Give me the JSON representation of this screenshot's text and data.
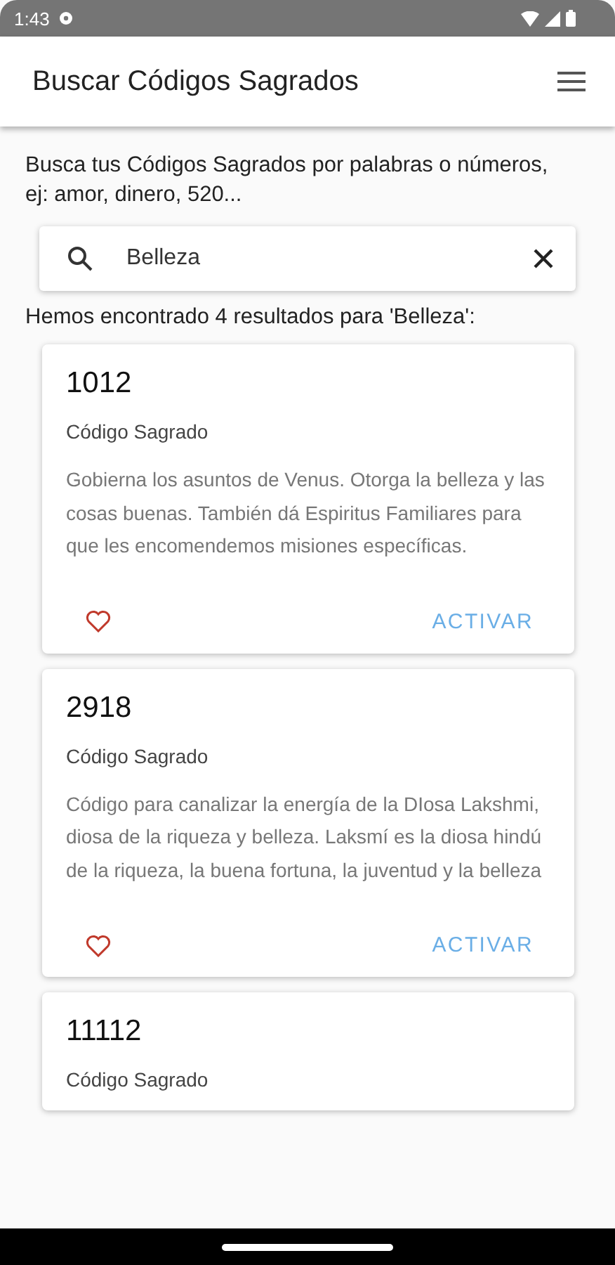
{
  "status_bar": {
    "time": "1:43"
  },
  "app_bar": {
    "title": "Buscar Códigos Sagrados"
  },
  "intro": "Busca tus Códigos Sagrados por palabras o números, ej: amor, dinero, 520...",
  "search": {
    "value": "Belleza"
  },
  "results_label": "Hemos encontrado 4 resultados para 'Belleza':",
  "results": [
    {
      "code": "1012",
      "subtitle": "Código Sagrado",
      "description": "Gobierna los asuntos de Venus. Otorga la belleza y las cosas buenas. También dá Espiritus Familiares para que les encomendemos misiones específicas.",
      "favorite": false,
      "action": "ACTIVAR"
    },
    {
      "code": "2918",
      "subtitle": "Código Sagrado",
      "description": "Código para canalizar la energía de la DIosa Lakshmi, diosa de la riqueza y belleza. Laksmí es la diosa hindú de la riqueza, la buena fortuna, la juventud y la belleza",
      "favorite": false,
      "action": "ACTIVAR"
    },
    {
      "code": "11112",
      "subtitle": "Código Sagrado"
    }
  ]
}
